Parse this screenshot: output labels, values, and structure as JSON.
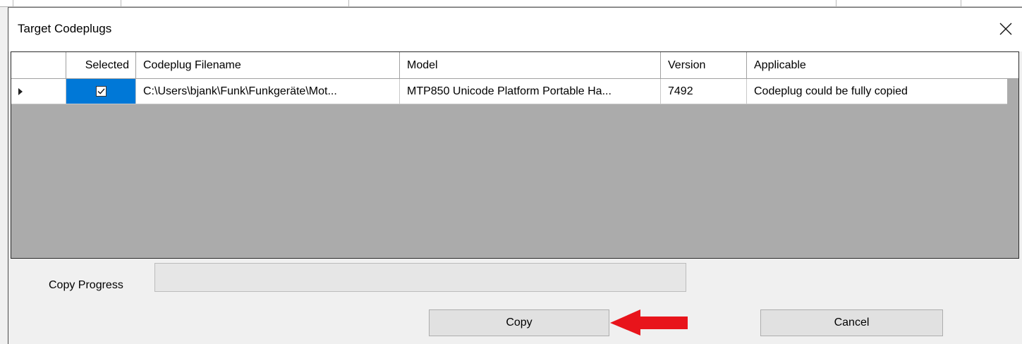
{
  "window": {
    "title": "Target Codeplugs",
    "close_label": "×"
  },
  "grid": {
    "columns": [
      "",
      "Selected",
      "Codeplug Filename",
      "Model",
      "Version",
      "Applicable"
    ],
    "rows": [
      {
        "selected": true,
        "filename": "C:\\Users\\bjank\\Funk\\Funkgeräte\\Mot...",
        "model": "MTP850 Unicode Platform Portable Ha...",
        "version": "7492",
        "applicable": "Codeplug could be fully copied"
      }
    ]
  },
  "progress": {
    "label": "Copy Progress",
    "value": 0
  },
  "buttons": {
    "copy": "Copy",
    "cancel": "Cancel"
  },
  "colors": {
    "selection": "#0078d7",
    "grid_background": "#ababab",
    "annotation_arrow": "#e8141b"
  }
}
